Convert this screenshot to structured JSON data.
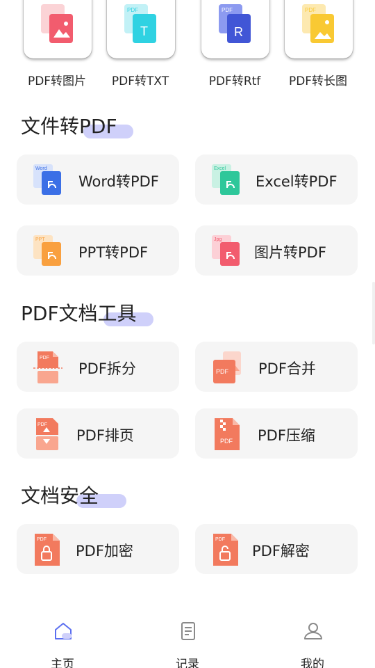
{
  "top_tools": [
    {
      "label": "PDF转图片"
    },
    {
      "label": "PDF转TXT"
    },
    {
      "label": "PDF转Rtf"
    },
    {
      "label": "PDF转长图"
    }
  ],
  "sections": {
    "file_to_pdf": {
      "title": "文件转PDF",
      "items": [
        {
          "label": "Word转PDF",
          "badge": "Word"
        },
        {
          "label": "Excel转PDF",
          "badge": "Excel"
        },
        {
          "label": "PPT转PDF",
          "badge": "PPT"
        },
        {
          "label": "图片转PDF",
          "badge": "Jpg"
        }
      ]
    },
    "pdf_tools": {
      "title": "PDF文档工具",
      "items": [
        {
          "label": "PDF拆分"
        },
        {
          "label": "PDF合并"
        },
        {
          "label": "PDF排页"
        },
        {
          "label": "PDF压缩"
        }
      ]
    },
    "doc_security": {
      "title": "文档安全",
      "items": [
        {
          "label": "PDF加密"
        },
        {
          "label": "PDF解密"
        }
      ]
    }
  },
  "icon_text": {
    "pdf": "PDF",
    "t": "T",
    "r": "R"
  },
  "nav": [
    {
      "label": "主页",
      "icon": "home-icon",
      "active": true
    },
    {
      "label": "记录",
      "icon": "record-icon",
      "active": false
    },
    {
      "label": "我的",
      "icon": "profile-icon",
      "active": false
    }
  ],
  "colors": {
    "accent": "#5b6ff0",
    "highlight": "#cfd0fa",
    "pdf_orange": "#f27a5e",
    "word_blue": "#3b6fe6",
    "excel_green": "#2ec79a",
    "ppt_orange": "#f9a03f",
    "image_red": "#f25c6e",
    "txt_cyan": "#2fd2e2",
    "rtf_indigo": "#4156d6",
    "long_yellow": "#f9c933"
  }
}
